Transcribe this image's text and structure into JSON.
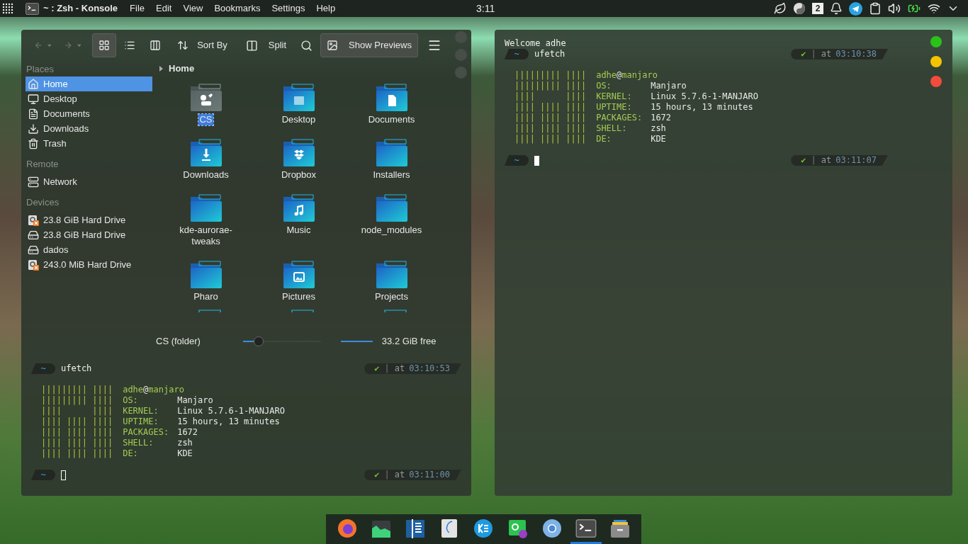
{
  "top_bar": {
    "title": "~ : Zsh - Konsole",
    "menus": [
      "File",
      "Edit",
      "View",
      "Bookmarks",
      "Settings",
      "Help"
    ],
    "clock": "3:11",
    "tray": [
      {
        "kind": "leaf"
      },
      {
        "kind": "yinyang"
      },
      {
        "kind": "digit",
        "label": "2"
      },
      {
        "kind": "bell"
      },
      {
        "kind": "telegram"
      },
      {
        "kind": "clipboard"
      },
      {
        "kind": "volume"
      },
      {
        "kind": "battery"
      },
      {
        "kind": "wifi"
      },
      {
        "kind": "expand"
      }
    ]
  },
  "file_manager": {
    "toolbar": {
      "views": [
        {
          "kind": "icons",
          "selected": true
        },
        {
          "kind": "details",
          "selected": false
        },
        {
          "kind": "compact",
          "selected": false
        }
      ],
      "sort_label": "Sort By",
      "split_label": "Split",
      "previews": {
        "label": "Show Previews",
        "on": true
      }
    },
    "window_dots": [
      {
        "color": "#474d47"
      },
      {
        "color": "#474d47"
      },
      {
        "color": "#474d47"
      }
    ],
    "sidebar": [
      {
        "heading": "Places",
        "items": [
          {
            "label": "Home",
            "kind": "home",
            "selected": true
          },
          {
            "label": "Desktop",
            "kind": "desktop",
            "selected": false
          },
          {
            "label": "Documents",
            "kind": "document",
            "selected": false
          },
          {
            "label": "Downloads",
            "kind": "download",
            "selected": false
          },
          {
            "label": "Trash",
            "kind": "trash",
            "selected": false
          }
        ]
      },
      {
        "heading": "Remote",
        "items": [
          {
            "label": "Network",
            "kind": "network",
            "selected": false
          }
        ]
      },
      {
        "heading": "Devices",
        "items": [
          {
            "label": "23.8 GiB Hard Drive",
            "kind": "drive-error",
            "selected": false
          },
          {
            "label": "23.8 GiB Hard Drive",
            "kind": "drive",
            "selected": false
          },
          {
            "label": "dados",
            "kind": "drive",
            "selected": false
          },
          {
            "label": "243.0 MiB Hard Drive",
            "kind": "drive-error",
            "selected": false
          }
        ]
      }
    ],
    "breadcrumb": "Home",
    "files": [
      {
        "name": "CS",
        "kind": "settings",
        "selected": true
      },
      {
        "name": "Desktop",
        "kind": "desktop",
        "selected": false
      },
      {
        "name": "Documents",
        "kind": "document",
        "selected": false
      },
      {
        "name": "Downloads",
        "kind": "download",
        "selected": false
      },
      {
        "name": "Dropbox",
        "kind": "dropbox",
        "selected": false
      },
      {
        "name": "Installers",
        "kind": "plain",
        "selected": false
      },
      {
        "name": "kde-aurorae-tweaks",
        "kind": "plain",
        "selected": false
      },
      {
        "name": "Music",
        "kind": "music",
        "selected": false
      },
      {
        "name": "node_modules",
        "kind": "plain",
        "selected": false
      },
      {
        "name": "Pharo",
        "kind": "plain",
        "selected": false
      },
      {
        "name": "Pictures",
        "kind": "picture",
        "selected": false
      },
      {
        "name": "Projects",
        "kind": "plain",
        "selected": false
      }
    ],
    "status": {
      "label": "CS (folder)",
      "zoom": {
        "level": 0.2
      },
      "free_space": "33.2 GiB free"
    }
  },
  "terminals": [
    {
      "blocks": [
        {
          "kind": "prompt",
          "dir": "~",
          "command": "ufetch",
          "status": {
            "mark": "✔",
            "separator": "|",
            "word": "at",
            "time": "03:10:53"
          }
        },
        {
          "kind": "ufetch",
          "user": "adhe",
          "at": "@",
          "host": "manjaro",
          "art": [
            "||||||||| ||||",
            "||||||||| ||||",
            "||||      ||||",
            "|||| |||| ||||",
            "|||| |||| ||||",
            "|||| |||| ||||",
            "|||| |||| ||||"
          ],
          "rows": [
            {
              "label": "OS:",
              "value": "Manjaro"
            },
            {
              "label": "KERNEL:",
              "value": "Linux 5.7.6-1-MANJARO"
            },
            {
              "label": "UPTIME:",
              "value": "15 hours, 13 minutes"
            },
            {
              "label": "PACKAGES:",
              "value": "1672"
            },
            {
              "label": "SHELL:",
              "value": "zsh"
            },
            {
              "label": "DE:",
              "value": "KDE"
            }
          ]
        },
        {
          "kind": "prompt",
          "dir": "~",
          "cursor": {
            "focused": false
          },
          "status": {
            "mark": "✔",
            "separator": "|",
            "word": "at",
            "time": "03:11:00"
          }
        }
      ]
    },
    {
      "window_controls": [
        {
          "color": "#2ac21a"
        },
        {
          "color": "#f5c400"
        },
        {
          "color": "#f24c3d"
        }
      ],
      "blocks": [
        {
          "kind": "text",
          "text": "Welcome adhe"
        },
        {
          "kind": "prompt",
          "dir": "~",
          "command": "ufetch",
          "status": {
            "mark": "✔",
            "separator": "|",
            "word": "at",
            "time": "03:10:38"
          }
        },
        {
          "kind": "ufetch",
          "user": "adhe",
          "at": "@",
          "host": "manjaro",
          "art": [
            "||||||||| ||||",
            "||||||||| ||||",
            "||||      ||||",
            "|||| |||| ||||",
            "|||| |||| ||||",
            "|||| |||| ||||",
            "|||| |||| ||||"
          ],
          "rows": [
            {
              "label": "OS:",
              "value": "Manjaro"
            },
            {
              "label": "KERNEL:",
              "value": "Linux 5.7.6-1-MANJARO"
            },
            {
              "label": "UPTIME:",
              "value": "15 hours, 13 minutes"
            },
            {
              "label": "PACKAGES:",
              "value": "1672"
            },
            {
              "label": "SHELL:",
              "value": "zsh"
            },
            {
              "label": "DE:",
              "value": "KDE"
            }
          ]
        },
        {
          "kind": "prompt",
          "dir": "~",
          "cursor": {
            "focused": true
          },
          "status": {
            "mark": "✔",
            "separator": "|",
            "word": "at",
            "time": "03:11:07"
          }
        }
      ]
    }
  ],
  "dock": [
    {
      "kind": "firefox",
      "active": false
    },
    {
      "kind": "monitor",
      "active": false
    },
    {
      "kind": "notes",
      "active": false
    },
    {
      "kind": "writer",
      "active": false
    },
    {
      "kind": "kbase",
      "active": false
    },
    {
      "kind": "qt",
      "active": false
    },
    {
      "kind": "chromium",
      "active": false
    },
    {
      "kind": "terminal",
      "active": true
    },
    {
      "kind": "archive",
      "active": false
    }
  ]
}
